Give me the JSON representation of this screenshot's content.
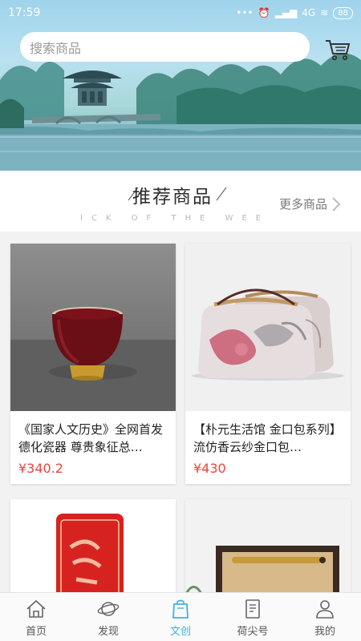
{
  "status_bar": {
    "time": "17:59",
    "network": "4G",
    "battery": "88"
  },
  "search": {
    "placeholder": "搜索商品"
  },
  "section": {
    "title": "推荐商品",
    "subtitle": "ICK OF THE WEE",
    "more_label": "更多商品"
  },
  "products": [
    {
      "name": "《国家人文历史》全网首发 德化瓷器 尊贵象征总…",
      "price": "¥340.2"
    },
    {
      "name": "【朴元生活馆 金口包系列】流仿香云纱金口包…",
      "price": "¥430"
    },
    {
      "name": "",
      "price": ""
    },
    {
      "name": "",
      "price": ""
    }
  ],
  "tabbar": {
    "items": [
      {
        "label": "首页",
        "icon": "home-icon"
      },
      {
        "label": "发现",
        "icon": "planet-icon"
      },
      {
        "label": "文创",
        "icon": "bag-icon",
        "active": true
      },
      {
        "label": "荷尖号",
        "icon": "document-icon"
      },
      {
        "label": "我的",
        "icon": "user-icon"
      }
    ]
  },
  "colors": {
    "accent": "#3fb1e6",
    "price": "#e8463c"
  }
}
